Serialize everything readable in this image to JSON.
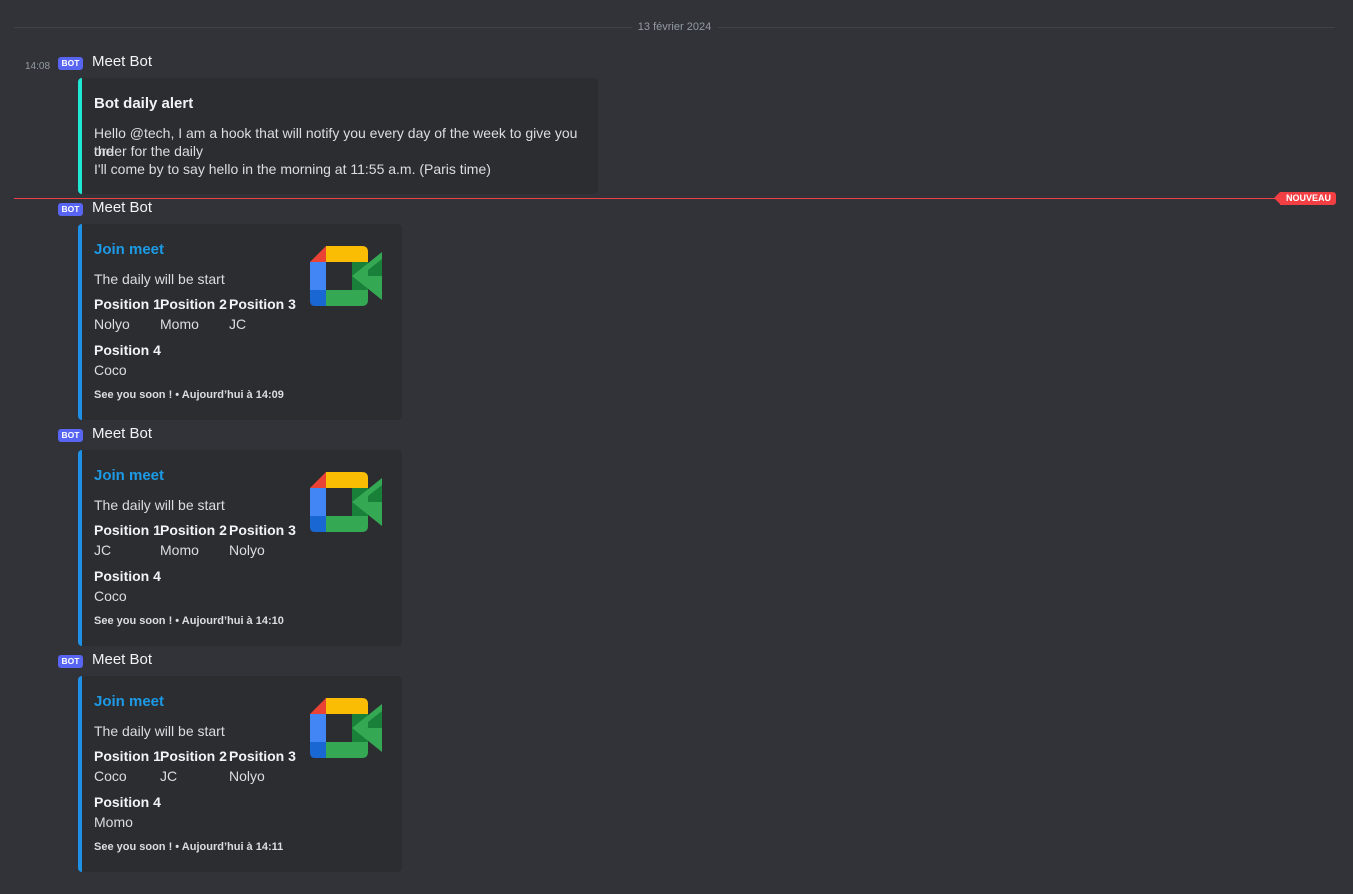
{
  "date_divider": "13 février 2024",
  "new_badge": "NOUVEAU",
  "bot_tag": "BOT",
  "first_message": {
    "time": "14:08",
    "author": "Meet Bot",
    "embed": {
      "title": "Bot daily alert",
      "line1": "Hello @tech, I am a hook that will notify you every day of the week to give you the",
      "line2": "order for the daily",
      "line3": "I'll come by to say hello in the morning at 11:55 a.m. (Paris time)"
    }
  },
  "messages": [
    {
      "author": "Meet Bot",
      "title": "Join meet",
      "description": "The daily will be start",
      "fields": [
        {
          "name": "Position 1",
          "value": "Nolyo"
        },
        {
          "name": "Position 2",
          "value": "Momo"
        },
        {
          "name": "Position 3",
          "value": "JC"
        },
        {
          "name": "Position 4",
          "value": "Coco"
        }
      ],
      "footer": "See you soon ! • Aujourd’hui à 14:09",
      "thumbnail_icon": "google-meet-logo"
    },
    {
      "author": "Meet Bot",
      "title": "Join meet",
      "description": "The daily will be start",
      "fields": [
        {
          "name": "Position 1",
          "value": "JC"
        },
        {
          "name": "Position 2",
          "value": "Momo"
        },
        {
          "name": "Position 3",
          "value": "Nolyo"
        },
        {
          "name": "Position 4",
          "value": "Coco"
        }
      ],
      "footer": "See you soon ! • Aujourd’hui à 14:10",
      "thumbnail_icon": "google-meet-logo"
    },
    {
      "author": "Meet Bot",
      "title": "Join meet",
      "description": "The daily will be start",
      "fields": [
        {
          "name": "Position 1",
          "value": "Coco"
        },
        {
          "name": "Position 2",
          "value": "JC"
        },
        {
          "name": "Position 3",
          "value": "Nolyo"
        },
        {
          "name": "Position 4",
          "value": "Momo"
        }
      ],
      "footer": "See you soon ! • Aujourd’hui à 14:11",
      "thumbnail_icon": "google-meet-logo"
    }
  ],
  "colors": {
    "background": "#313338",
    "embed_background": "#2b2d31",
    "alert_accent": "#1ee8d4",
    "meet_accent": "#1e90e6",
    "link": "#1c9ae6",
    "new_divider": "#f23f43",
    "bot_tag": "#5865f2"
  }
}
